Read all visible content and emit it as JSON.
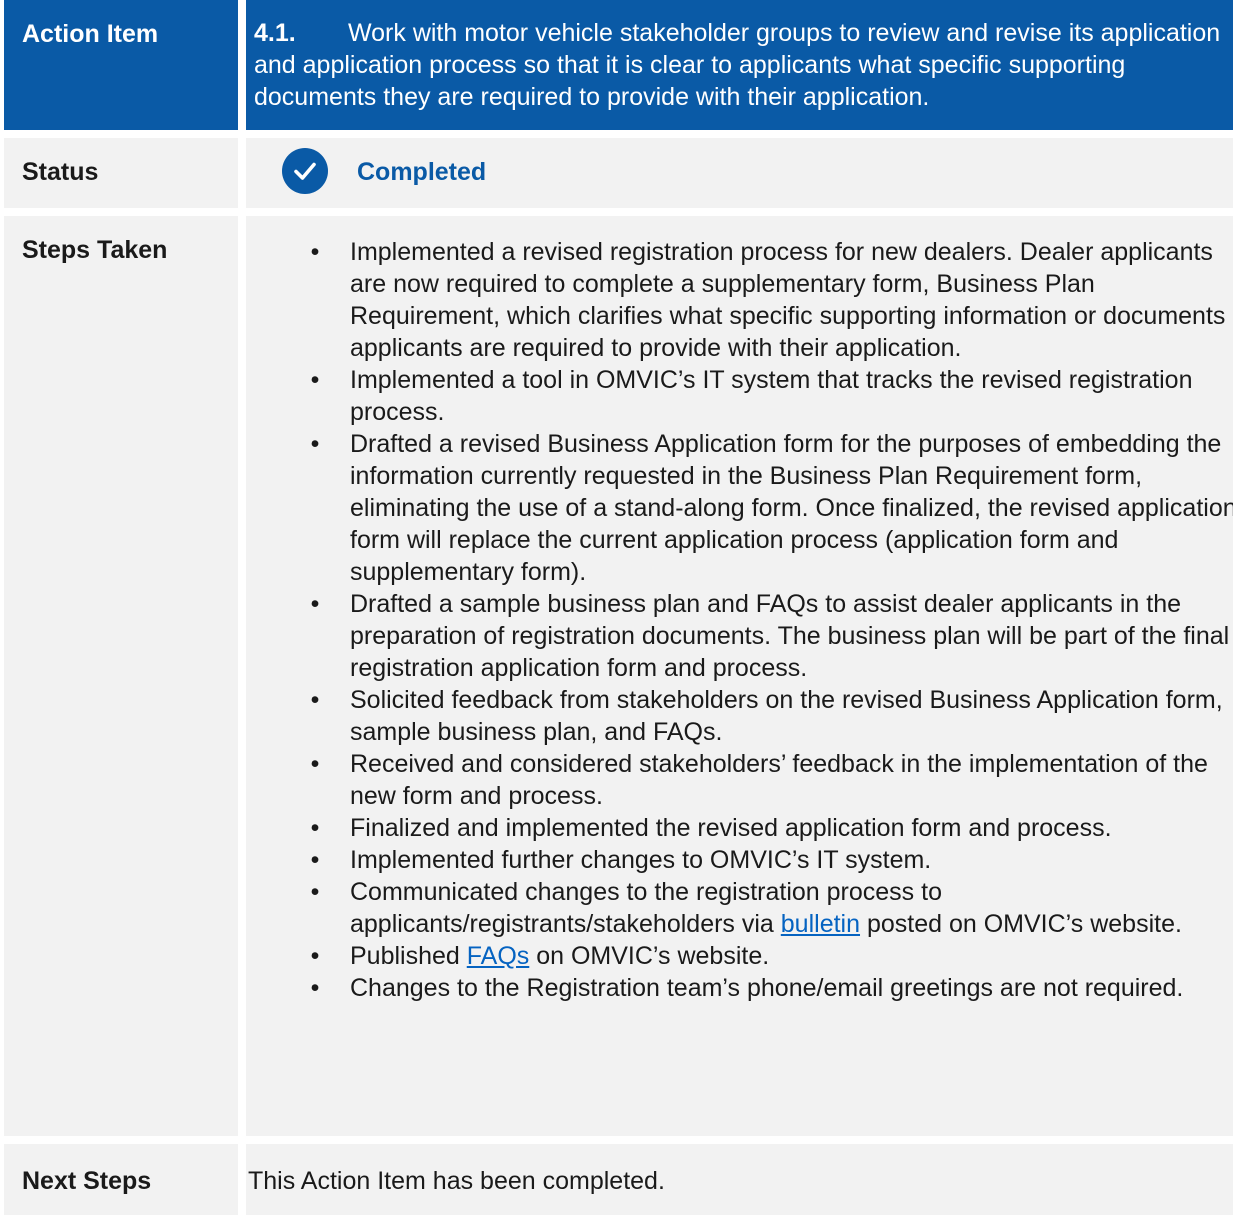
{
  "colors": {
    "header_bg": "#0a5aa6",
    "accent": "#0a5aa6",
    "cell_bg": "#f2f2f2",
    "link": "#0563c1"
  },
  "action": {
    "label": "Action Item",
    "number": "4.1.",
    "text": "Work with motor vehicle stakeholder groups to review and revise its application and application process so that it is clear to applicants what specific supporting documents they are required to provide with their application."
  },
  "status": {
    "label": "Status",
    "icon": "check-circle-icon",
    "value": "Completed"
  },
  "steps": {
    "label": "Steps Taken",
    "items": [
      {
        "text": "Implemented a revised registration process for new dealers. Dealer applicants are now required to complete a supplementary form, Business Plan Requirement, which clarifies what specific supporting information or documents applicants are required to provide with their application."
      },
      {
        "text": "Implemented a tool in OMVIC’s IT system that tracks the revised registration process."
      },
      {
        "text": "Drafted a revised Business Application form for the purposes of embedding the information currently requested in the Business Plan Requirement form, eliminating the use of a stand-along form. Once finalized, the revised application form will replace the current application process (application form and supplementary form)."
      },
      {
        "text": "Drafted a sample business plan and FAQs to assist dealer applicants in the preparation of registration documents. The business plan will be part of the final registration application form and process."
      },
      {
        "text": "Solicited feedback from stakeholders on the revised Business Application form, sample business plan, and FAQs."
      },
      {
        "text": "Received and considered stakeholders’ feedback in the implementation of the new form and process."
      },
      {
        "text": "Finalized and implemented the revised application form and process."
      },
      {
        "text": "Implemented further changes to OMVIC’s IT system."
      },
      {
        "before": "Communicated changes to the registration process to applicants/registrants/stakeholders via ",
        "link": "bulletin",
        "after": " posted on OMVIC’s website."
      },
      {
        "before": "Published ",
        "link": "FAQs",
        "after": " on OMVIC’s website."
      },
      {
        "text": "Changes to the Registration team’s phone/email greetings are not required."
      }
    ]
  },
  "next_steps": {
    "label": "Next Steps",
    "text": "This Action Item has been completed."
  }
}
